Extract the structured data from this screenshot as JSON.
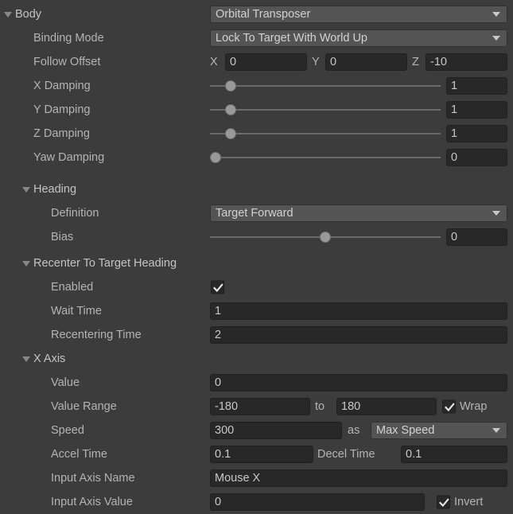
{
  "panel": {
    "title": "Body",
    "component_type": "Orbital Transposer"
  },
  "body": {
    "foldout_label": "Body",
    "type_value": "Orbital Transposer",
    "binding_mode": {
      "label": "Binding Mode",
      "value": "Lock To Target With World Up"
    },
    "follow_offset": {
      "label": "Follow Offset",
      "x_label": "X",
      "x_value": "0",
      "y_label": "Y",
      "y_value": "0",
      "z_label": "Z",
      "z_value": "-10"
    },
    "x_damping": {
      "label": "X Damping",
      "value": "1",
      "slider_pct": 7
    },
    "y_damping": {
      "label": "Y Damping",
      "value": "1",
      "slider_pct": 7
    },
    "z_damping": {
      "label": "Z Damping",
      "value": "1",
      "slider_pct": 7
    },
    "yaw_damping": {
      "label": "Yaw Damping",
      "value": "0",
      "slider_pct": 0
    }
  },
  "heading": {
    "foldout_label": "Heading",
    "definition": {
      "label": "Definition",
      "value": "Target Forward"
    },
    "bias": {
      "label": "Bias",
      "value": "0",
      "slider_pct": 50
    }
  },
  "recenter": {
    "foldout_label": "Recenter To Target Heading",
    "enabled": {
      "label": "Enabled",
      "checked": true
    },
    "wait_time": {
      "label": "Wait Time",
      "value": "1"
    },
    "recentering_time": {
      "label": "Recentering Time",
      "value": "2"
    }
  },
  "x_axis": {
    "foldout_label": "X Axis",
    "value": {
      "label": "Value",
      "value": "0"
    },
    "value_range": {
      "label": "Value Range",
      "min": "-180",
      "separator": "to",
      "max": "180",
      "wrap_label": "Wrap",
      "wrap_checked": true
    },
    "speed": {
      "label": "Speed",
      "value": "300",
      "as_label": "as",
      "mode": "Max Speed"
    },
    "accel": {
      "label": "Accel Time",
      "value": "0.1",
      "decel_label": "Decel Time",
      "decel_value": "0.1"
    },
    "input_axis_name": {
      "label": "Input Axis Name",
      "value": "Mouse X"
    },
    "input_axis_value": {
      "label": "Input Axis Value",
      "value": "0",
      "invert_label": "Invert",
      "invert_checked": true
    }
  },
  "colors": {
    "background": "#3c3c3c",
    "field_fill": "#282828",
    "dropdown_fill": "#545454",
    "text": "#b4b4b4",
    "slider_handle": "#999999"
  }
}
